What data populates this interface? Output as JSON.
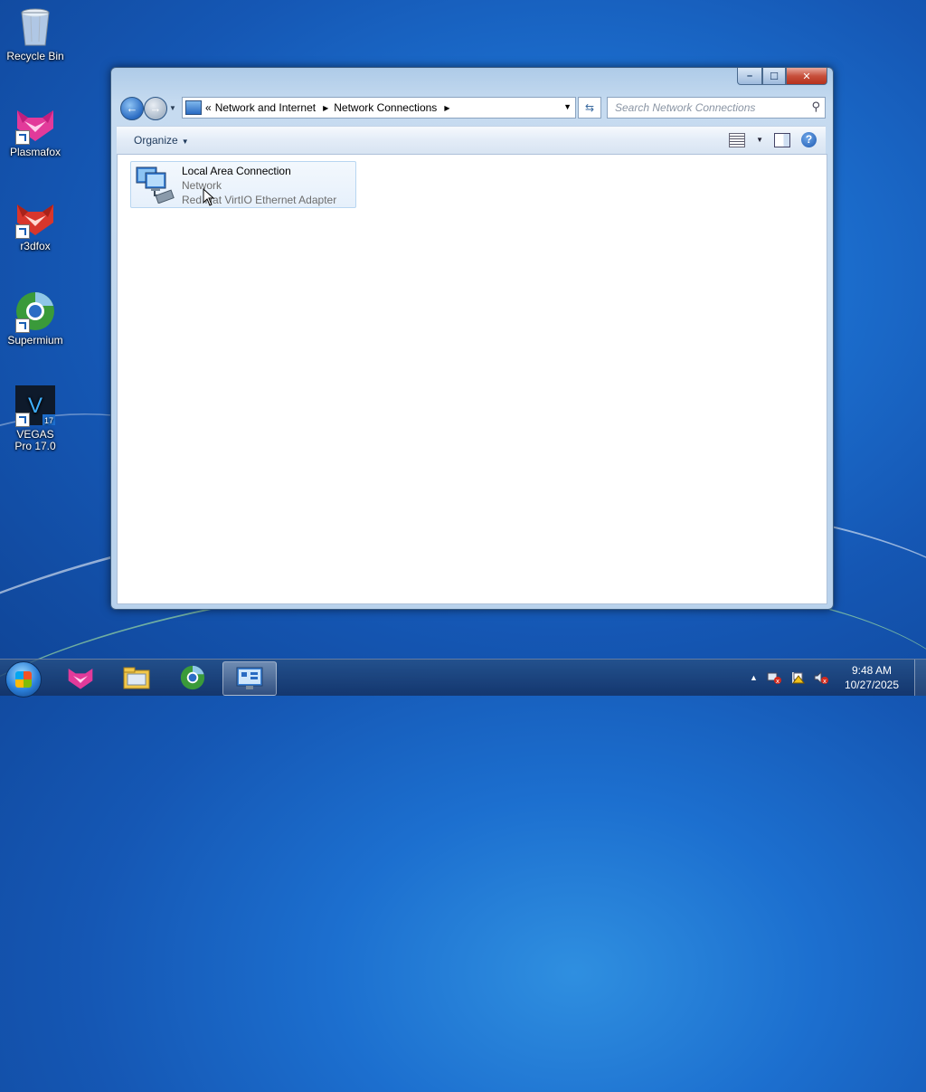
{
  "desktop": {
    "icons": [
      {
        "label": "Recycle Bin"
      },
      {
        "label": "Plasmafox"
      },
      {
        "label": "r3dfox"
      },
      {
        "label": "Supermium"
      },
      {
        "label": "VEGAS Pro 17.0"
      }
    ]
  },
  "window": {
    "title": "Network Connections",
    "controls": {
      "minimize": "–",
      "maximize": "☐",
      "close": "✕"
    },
    "address": {
      "prefix": "«",
      "crumbs": [
        "Network and Internet",
        "Network Connections"
      ]
    },
    "search": {
      "placeholder": "Search Network Connections"
    },
    "toolbar": {
      "organize": "Organize"
    },
    "item": {
      "name": "Local Area Connection",
      "status": "Network",
      "device": "Red Hat VirtIO Ethernet Adapter"
    }
  },
  "taskbar": {
    "clock": {
      "time": "9:48 AM",
      "date": "10/27/2025"
    },
    "tray_expand": "▲"
  },
  "colors": {
    "desktop_bg": "#1c6fcf",
    "taskbar": "#1a3f73",
    "selection": "#e6f0fb"
  }
}
